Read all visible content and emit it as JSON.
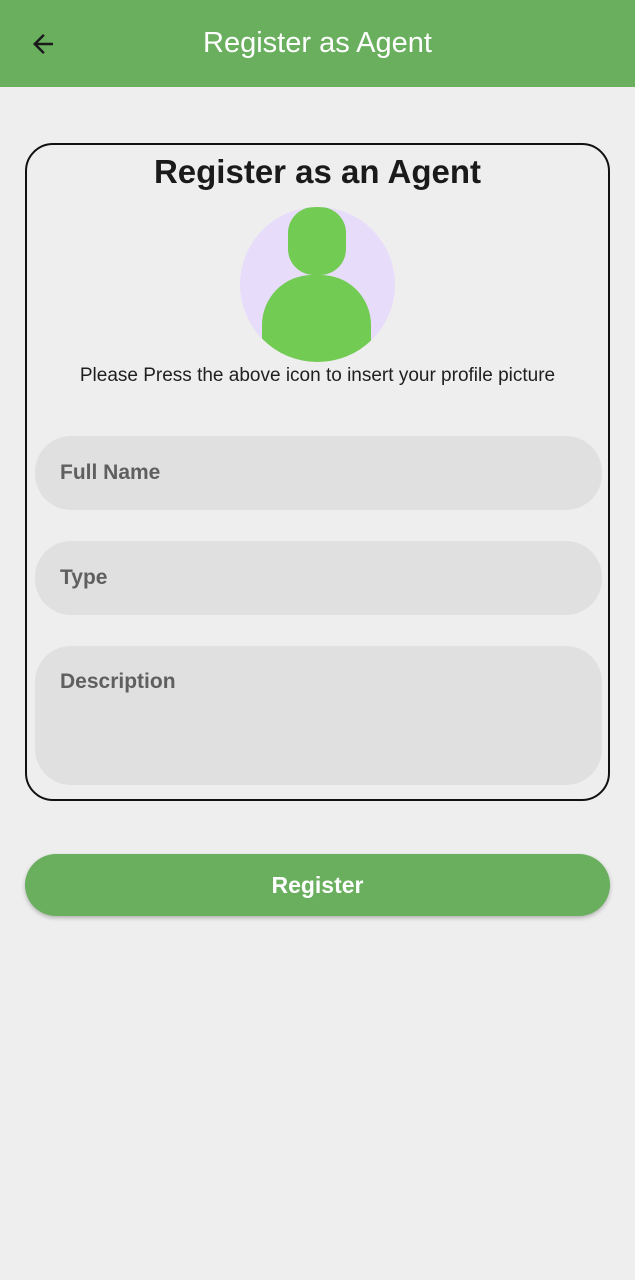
{
  "appbar": {
    "title": "Register as Agent",
    "back_icon": "arrow-left-icon",
    "background": "#69af5e"
  },
  "card": {
    "title": "Register as an Agent",
    "avatar_icon": "person-placeholder-icon",
    "hint": "Please Press the above icon to insert your profile picture",
    "fields": {
      "full_name_placeholder": "Full Name",
      "type_placeholder": "Type",
      "description_placeholder": "Description"
    }
  },
  "actions": {
    "register_label": "Register"
  },
  "colors": {
    "accent": "#69af5e",
    "avatar_bg": "#e8dcfb",
    "avatar_fg": "#72cb53",
    "field_bg": "#e0e0e0",
    "page_bg": "#eeeeee"
  }
}
